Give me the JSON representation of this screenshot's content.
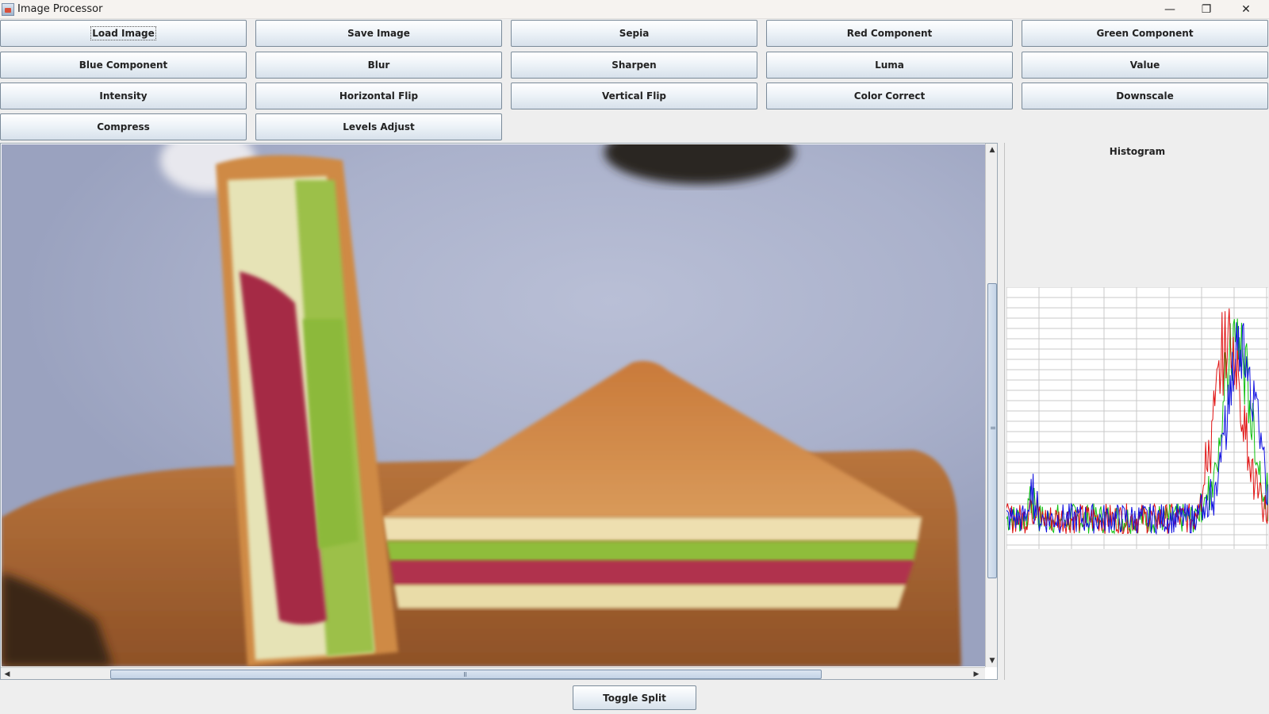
{
  "window": {
    "title": "Image Processor",
    "icons": {
      "app": "java-app-icon",
      "min": "minimize-icon",
      "max": "restore-icon",
      "close": "close-icon"
    }
  },
  "toolbar": {
    "buttons": [
      "Load Image",
      "Save Image",
      "Sepia",
      "Red Component",
      "Green Component",
      "Blue Component",
      "Blur",
      "Sharpen",
      "Luma",
      "Value",
      "Intensity",
      "Horizontal Flip",
      "Vertical Flip",
      "Color Correct",
      "Downscale",
      "Compress",
      "Levels Adjust"
    ],
    "focused": "Load Image"
  },
  "viewer": {
    "content": "photo",
    "vertical_scroll_fraction": 0.27,
    "horizontal_scroll_fraction": 0.11
  },
  "histogram": {
    "title": "Histogram",
    "colors": {
      "red": "#e01010",
      "green": "#10c010",
      "blue": "#1010e0",
      "grid": "#c8c8c8"
    }
  },
  "footer": {
    "toggle_label": "Toggle Split"
  }
}
